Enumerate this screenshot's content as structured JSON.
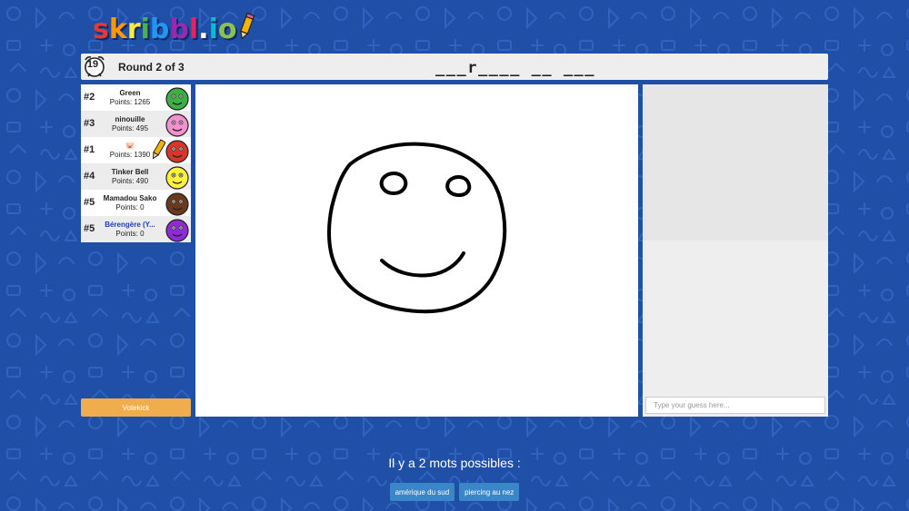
{
  "logo": {
    "letters": [
      {
        "char": "s",
        "color": "#e53935"
      },
      {
        "char": "k",
        "color": "#ff9800"
      },
      {
        "char": "r",
        "color": "#ffeb3b"
      },
      {
        "char": "i",
        "color": "#4caf50"
      },
      {
        "char": "b",
        "color": "#2196f3"
      },
      {
        "char": "b",
        "color": "#9c27b0"
      },
      {
        "char": "l",
        "color": "#e91e63"
      },
      {
        "char": ".",
        "color": "#ffffff"
      },
      {
        "char": "i",
        "color": "#00bcd4"
      },
      {
        "char": "o",
        "color": "#8bc34a"
      }
    ]
  },
  "header": {
    "timer": "19",
    "round_text": "Round 2 of 3",
    "word_hint": "___r____ __ ___"
  },
  "players": [
    {
      "rank": "#2",
      "name": "Green",
      "points": "Points: 1265",
      "avatar_color": "#3cb043",
      "self": false,
      "drawing": false
    },
    {
      "rank": "#3",
      "name": "ninouille",
      "points": "Points: 495",
      "avatar_color": "#f48fd0",
      "self": false,
      "drawing": false
    },
    {
      "rank": "#1",
      "name": "🐷",
      "points": "Points: 1390",
      "avatar_color": "#d9362b",
      "self": false,
      "drawing": true
    },
    {
      "rank": "#4",
      "name": "Tinker Bell",
      "points": "Points: 490",
      "avatar_color": "#fff23a",
      "self": false,
      "drawing": false
    },
    {
      "rank": "#5",
      "name": "Mamadou Sako",
      "points": "Points: 0",
      "avatar_color": "#6b3a1e",
      "self": false,
      "drawing": false
    },
    {
      "rank": "#5",
      "name": "Bérengère (Y...",
      "points": "Points: 0",
      "avatar_color": "#8e2bd6",
      "self": true,
      "drawing": false
    }
  ],
  "votekick_label": "Votekick",
  "chat": {
    "placeholder": "Type your guess here..."
  },
  "words": {
    "title": "Il y a 2 mots possibles :",
    "options": [
      "amérique du sud",
      "piercing au nez"
    ]
  },
  "colors": {
    "background": "#1f4fa6",
    "votekick": "#f0ad4e",
    "word_button": "#3a86c8"
  }
}
